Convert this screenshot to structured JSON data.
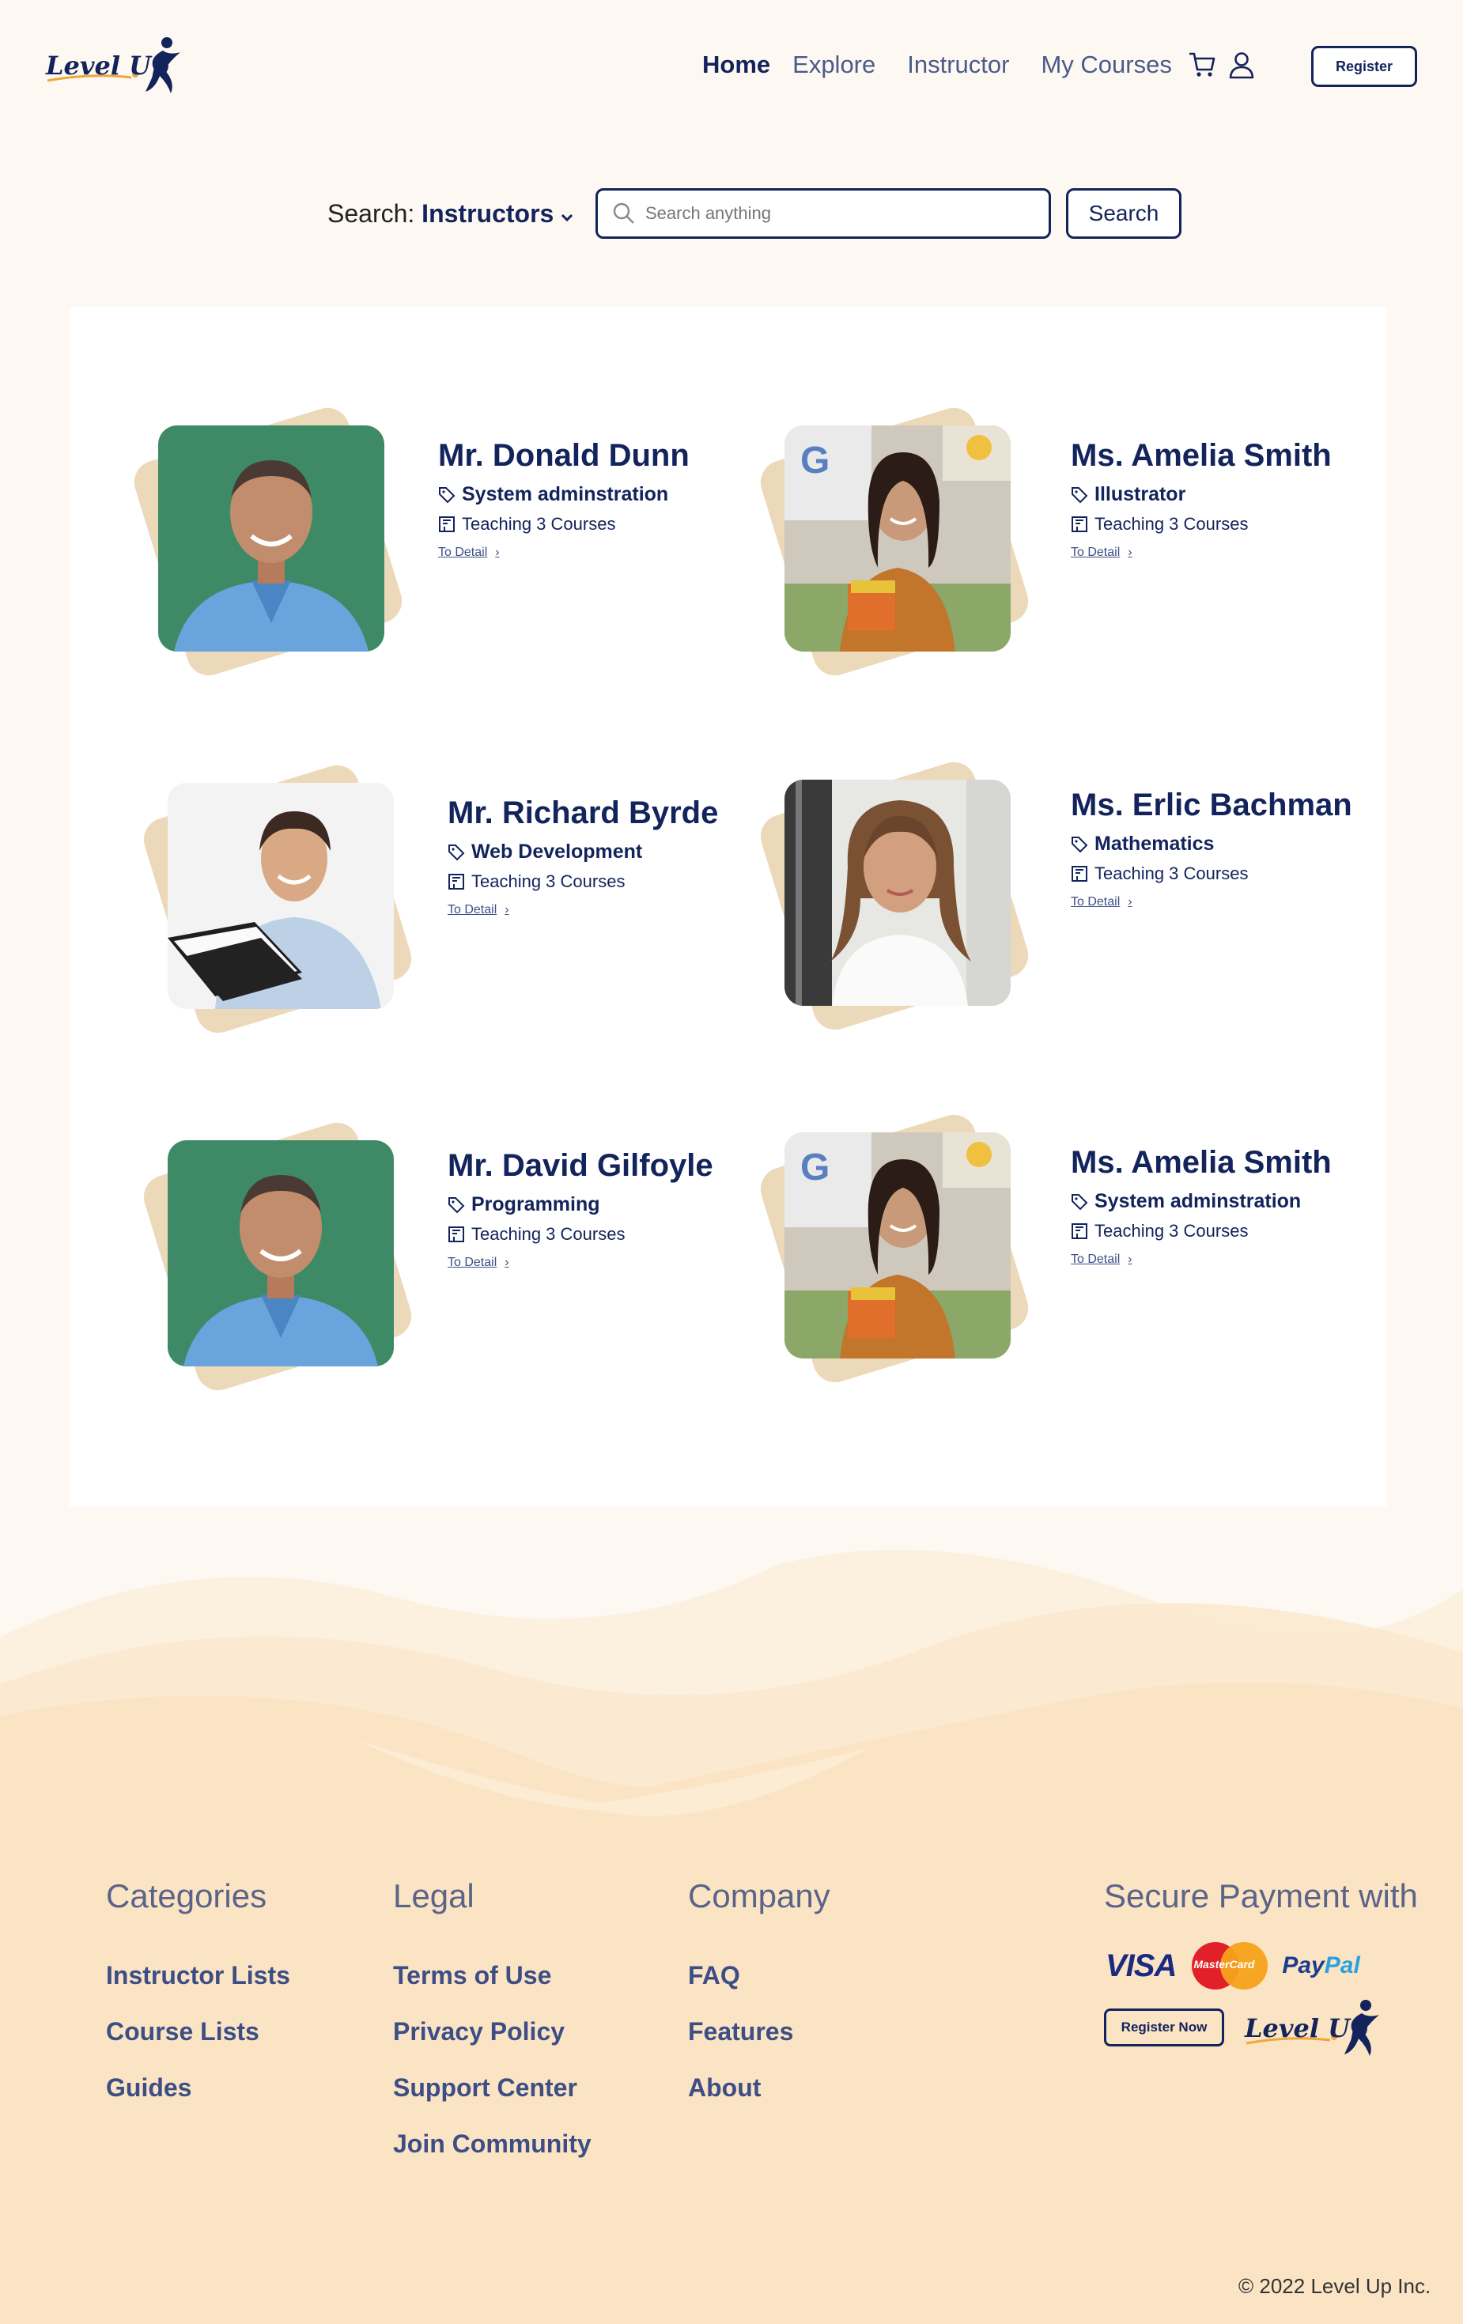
{
  "header": {
    "logo_text": "Level Up",
    "nav": [
      "Home",
      "Explore",
      "Instructor",
      "My Courses"
    ],
    "register_label": "Register"
  },
  "search": {
    "label": "Search:",
    "category": "Instructors",
    "placeholder": "Search anything",
    "button_label": "Search"
  },
  "instructors": [
    {
      "name": "Mr. Donald Dunn",
      "skill": "System adminstration",
      "courses": "Teaching 3 Courses",
      "detail": "To Detail"
    },
    {
      "name": "Ms. Amelia Smith",
      "skill": "Illustrator",
      "courses": "Teaching 3 Courses",
      "detail": "To Detail"
    },
    {
      "name": "Mr. Richard Byrde",
      "skill": "Web Development",
      "courses": "Teaching 3 Courses",
      "detail": "To Detail"
    },
    {
      "name": "Ms. Erlic Bachman",
      "skill": "Mathematics",
      "courses": "Teaching 3 Courses",
      "detail": "To Detail"
    },
    {
      "name": "Mr. David Gilfoyle",
      "skill": "Programming",
      "courses": "Teaching 3 Courses",
      "detail": "To Detail"
    },
    {
      "name": "Ms. Amelia Smith",
      "skill": "System adminstration",
      "courses": "Teaching 3 Courses",
      "detail": "To Detail"
    }
  ],
  "footer": {
    "categories": {
      "title": "Categories",
      "links": [
        "Instructor Lists",
        "Course Lists",
        "Guides"
      ]
    },
    "legal": {
      "title": "Legal",
      "links": [
        "Terms of Use",
        "Privacy Policy",
        "Support Center",
        "Join Community"
      ]
    },
    "company": {
      "title": "Company",
      "links": [
        "FAQ",
        "Features",
        "About"
      ]
    },
    "payment": {
      "title": "Secure Payment with",
      "visa": "VISA",
      "mastercard": "MasterCard",
      "paypal_a": "Pay",
      "paypal_b": "Pal",
      "register_now": "Register Now",
      "logo_text": "Level Up"
    },
    "copyright": "© 2022 Level Up Inc."
  },
  "colors": {
    "navy": "#13235b",
    "cream": "#fdf8f1",
    "tan": "#ecd9b9",
    "footer_bg": "#fbe7c8"
  }
}
